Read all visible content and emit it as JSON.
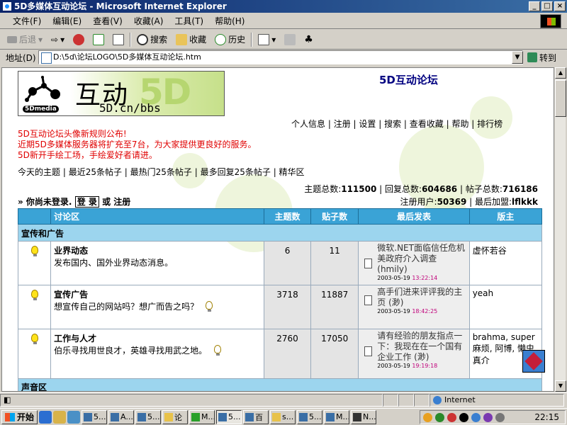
{
  "window": {
    "title": "5D多媒体互动论坛 - Microsoft Internet Explorer",
    "controls": [
      "_",
      "□",
      "×"
    ]
  },
  "menu": [
    "文件(F)",
    "编辑(E)",
    "查看(V)",
    "收藏(A)",
    "工具(T)",
    "帮助(H)"
  ],
  "toolbar": {
    "back": "后退",
    "search": "搜索",
    "favorites": "收藏",
    "history": "历史"
  },
  "address": {
    "label": "地址(D)",
    "value": "D:\\5d\\论坛LOGO\\5D多媒体互动论坛.htm",
    "go": "转到"
  },
  "page": {
    "logo": {
      "word1": "互动",
      "big": "5D",
      "url": "5D.cn/bbs",
      "badge": "5Dmedia"
    },
    "forum_title": "5D互动论坛",
    "top_nav": [
      "个人信息",
      "注册",
      "设置",
      "搜索",
      "查看收藏",
      "帮助",
      "排行榜"
    ],
    "notices": [
      "5D互动论坛头像新规则公布!",
      "近期5D多媒体服务器将扩充至7台，为大家提供更良好的服务。",
      "5D新开手绘工场，手绘爱好者请进。"
    ],
    "sub_nav": [
      "今天的主题",
      "最近25条帖子",
      "最热门25条帖子",
      "最多回复25条帖子",
      "精华区"
    ],
    "stats": {
      "topics_label": "主题总数:",
      "topics": "111500",
      "replies_label": "回复总数:",
      "replies": "604686",
      "posts_label": "帖子总数:",
      "posts": "716186",
      "users_label": "注册用户:",
      "users": "50369",
      "newest_label": "最后加盟:",
      "newest": "lflkkk"
    },
    "login": {
      "prefix": "» 你尚未登录.",
      "login_btn": "登 录",
      "or": "或",
      "register": "注册"
    },
    "table_headers": [
      "讨论区",
      "主题数",
      "贴子数",
      "最后发表",
      "版主"
    ],
    "category1": "宣传和广告",
    "forums": [
      {
        "name": "业界动态",
        "desc": "发布国内、国外业界动态消息。",
        "topics": "6",
        "posts": "11",
        "last_title": "微软.NET面临信任危机 美政府介入调查 (hmily)",
        "last_date": "2003-05-19",
        "last_time": "13:22:14",
        "mods": "虚怀若谷"
      },
      {
        "name": "宣传广告",
        "desc": "想宣传自己的网站吗？想广而告之吗？",
        "topics": "3718",
        "posts": "11887",
        "last_title": "高手们进来评评我的主页 (渺)",
        "last_date": "2003-05-19",
        "last_time": "18:42:25",
        "mods": "yeah"
      },
      {
        "name": "工作与人才",
        "desc": "伯乐寻找用世良才，英雄寻找用武之地。",
        "topics": "2760",
        "posts": "17050",
        "last_title": "请有经验的朋友指点一下：我现在在一个国有企业工作 (渺)",
        "last_date": "2003-05-19",
        "last_time": "19:19:18",
        "mods": "brahma, super麻烦, 阿博, 懒虫 真介"
      }
    ],
    "category2": "声音区"
  },
  "status": {
    "zone": "Internet"
  },
  "taskbar": {
    "start": "开始",
    "tasks": [
      "5...",
      "A...",
      "5...",
      "论",
      "M...",
      "5...",
      "百",
      "s...",
      "5...",
      "M...",
      "N..."
    ],
    "clock": "22:15"
  }
}
